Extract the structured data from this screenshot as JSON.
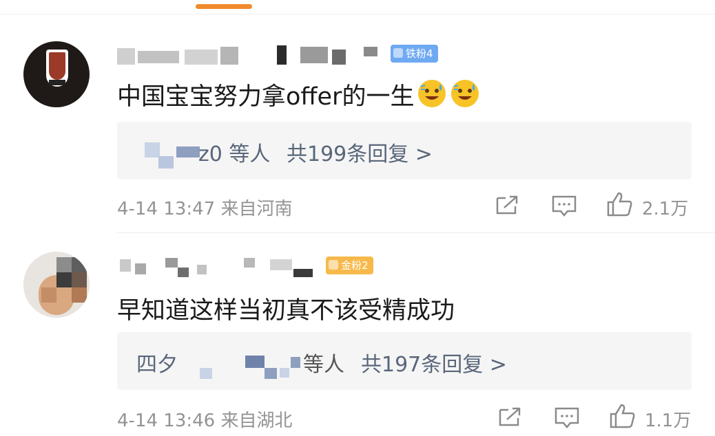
{
  "comments": [
    {
      "username": "",
      "badge": "铁粉4",
      "text": "中国宝宝努力拿offer的一生",
      "reply_prefix": "z0 等人",
      "reply_count": "共199条回复 >",
      "meta": "4-14 13:47 来自河南",
      "likes": "2.1万"
    },
    {
      "username": "",
      "badge": "金粉2",
      "text": "早知道这样当初真不该受精成功",
      "reply_prefix": "四夕",
      "reply_suffix": "等人",
      "reply_count": "共197条回复 >",
      "meta": "4-14 13:46 来自湖北",
      "likes": "1.1万"
    }
  ],
  "colors": {
    "accent_orange": "#f08a2c",
    "link_blue": "#59667a",
    "badge_blue": "#6ea9f2",
    "badge_gold": "#f6b94a"
  },
  "icons": [
    "share-icon",
    "comment-icon",
    "like-icon",
    "grinning-sweat-emoji"
  ]
}
